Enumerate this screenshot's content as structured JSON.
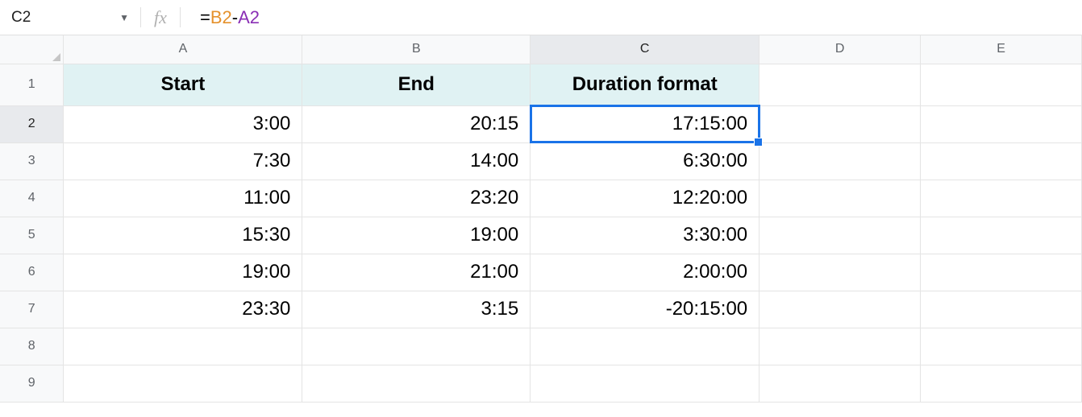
{
  "name_box": "C2",
  "formula": {
    "eq": "=",
    "ref1": "B2",
    "op": "-",
    "ref2": "A2"
  },
  "col_labels": [
    "A",
    "B",
    "C",
    "D",
    "E"
  ],
  "row_labels": [
    "1",
    "2",
    "3",
    "4",
    "5",
    "6",
    "7",
    "8",
    "9"
  ],
  "header_row": {
    "A": "Start",
    "B": "End",
    "C": "Duration format"
  },
  "rows": [
    {
      "A": "3:00",
      "B": "20:15",
      "C": "17:15:00"
    },
    {
      "A": "7:30",
      "B": "14:00",
      "C": "6:30:00"
    },
    {
      "A": "11:00",
      "B": "23:20",
      "C": "12:20:00"
    },
    {
      "A": "15:30",
      "B": "19:00",
      "C": "3:30:00"
    },
    {
      "A": "19:00",
      "B": "21:00",
      "C": "2:00:00"
    },
    {
      "A": "23:30",
      "B": "3:15",
      "C": "-20:15:00"
    }
  ],
  "active_cell": "C2"
}
